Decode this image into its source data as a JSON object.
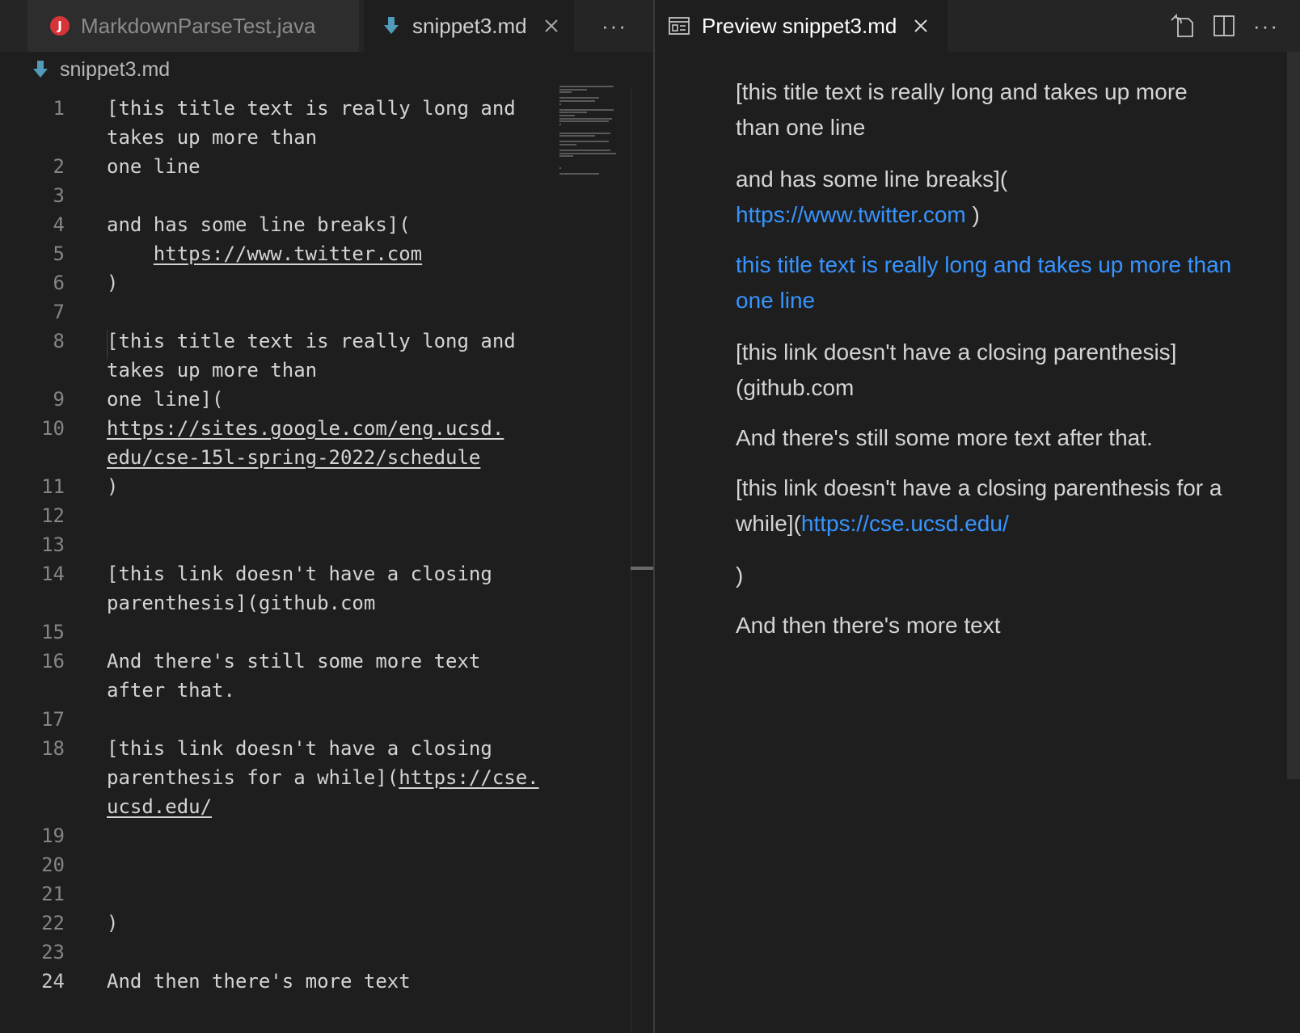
{
  "left_tabs": [
    {
      "label": "MarkdownParseTest.java",
      "icon": "java-icon",
      "active": false
    },
    {
      "label": "snippet3.md",
      "icon": "markdown-icon",
      "active": true
    }
  ],
  "left_more": "···",
  "breadcrumb": {
    "file": "snippet3.md"
  },
  "code_lines": [
    {
      "n": "1",
      "text": "[this title text is really long and"
    },
    {
      "n": "",
      "text": "takes up more than"
    },
    {
      "n": "2",
      "text": "one line"
    },
    {
      "n": "3",
      "text": ""
    },
    {
      "n": "4",
      "text": "and has some line breaks]("
    },
    {
      "n": "5",
      "text": "    https://www.twitter.com"
    },
    {
      "n": "6",
      "text": ")"
    },
    {
      "n": "7",
      "text": ""
    },
    {
      "n": "8",
      "text": "[this title text is really long and"
    },
    {
      "n": "",
      "text": "takes up more than"
    },
    {
      "n": "9",
      "text": "one line]("
    },
    {
      "n": "10",
      "text": "https://sites.google.com/eng.ucsd."
    },
    {
      "n": "",
      "text": "edu/cse-15l-spring-2022/schedule"
    },
    {
      "n": "11",
      "text": ")"
    },
    {
      "n": "12",
      "text": ""
    },
    {
      "n": "13",
      "text": ""
    },
    {
      "n": "14",
      "text": "[this link doesn't have a closing"
    },
    {
      "n": "",
      "text": "parenthesis](github.com"
    },
    {
      "n": "15",
      "text": ""
    },
    {
      "n": "16",
      "text": "And there's still some more text"
    },
    {
      "n": "",
      "text": "after that."
    },
    {
      "n": "17",
      "text": ""
    },
    {
      "n": "18",
      "text": "[this link doesn't have a closing"
    },
    {
      "n": "",
      "text": "parenthesis for a while](https://cse."
    },
    {
      "n": "",
      "text": "ucsd.edu/"
    },
    {
      "n": "19",
      "text": ""
    },
    {
      "n": "20",
      "text": ""
    },
    {
      "n": "21",
      "text": ""
    },
    {
      "n": "22",
      "text": ")"
    },
    {
      "n": "23",
      "text": ""
    },
    {
      "n": "24",
      "text": "And then there's more text"
    }
  ],
  "preview_tab": {
    "label": "Preview snippet3.md"
  },
  "right_more": "···",
  "preview": {
    "p1": "[this title text is really long and takes up more than one line",
    "p2_text": "and has some line breaks](",
    "p2_link": "https://www.twitter.com",
    "p2_tail": " )",
    "p3_link": "this title text is really long and takes up more than one line",
    "p4": "[this link doesn't have a closing parenthesis](github.com",
    "p5": "And there's still some more text after that.",
    "p6_text": "[this link doesn't have a closing parenthesis for a while](",
    "p6_link": "https://cse.ucsd.edu/",
    "p7": ")",
    "p8": "And then there's more text"
  },
  "colors": {
    "link": "#3794ff",
    "java_icon": "#d7343a",
    "markdown_icon": "#519aba"
  }
}
